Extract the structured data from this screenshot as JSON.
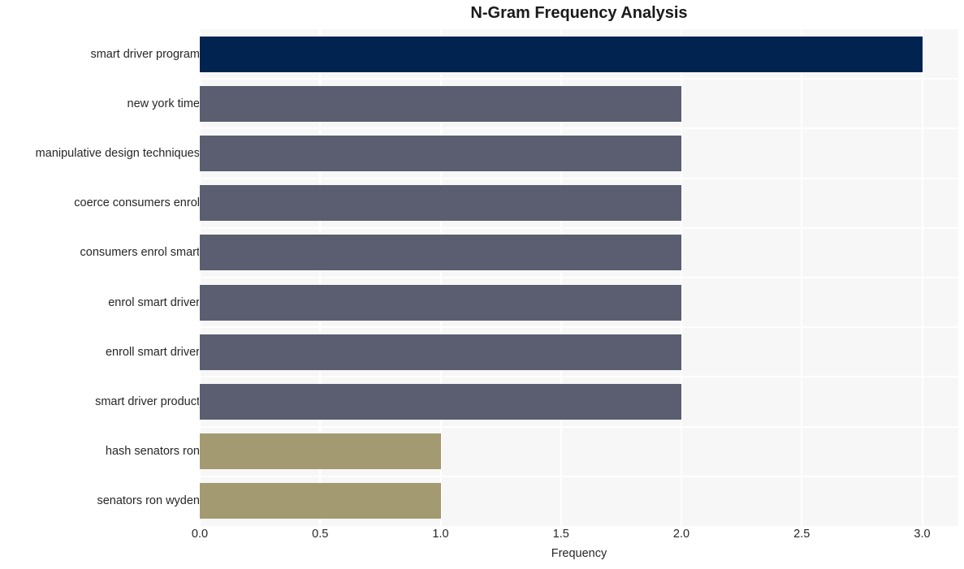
{
  "chart_data": {
    "type": "bar",
    "orientation": "horizontal",
    "title": "N-Gram Frequency Analysis",
    "xlabel": "Frequency",
    "ylabel": "",
    "xlim": [
      0.0,
      3.15
    ],
    "xticks": [
      "0.0",
      "0.5",
      "1.0",
      "1.5",
      "2.0",
      "2.5",
      "3.0"
    ],
    "xtick_values": [
      0.0,
      0.5,
      1.0,
      1.5,
      2.0,
      2.5,
      3.0
    ],
    "grid": true,
    "legend": "none",
    "categories": [
      "smart driver program",
      "new york time",
      "manipulative design techniques",
      "coerce consumers enrol",
      "consumers enrol smart",
      "enrol smart driver",
      "enroll smart driver",
      "smart driver product",
      "hash senators ron",
      "senators ron wyden"
    ],
    "values": [
      3,
      2,
      2,
      2,
      2,
      2,
      2,
      2,
      1,
      1
    ],
    "bar_colors": [
      "#012350",
      "#5a5e70",
      "#5a5e70",
      "#5a5e70",
      "#5a5e70",
      "#5a5e70",
      "#5a5e70",
      "#5a5e70",
      "#a39a72",
      "#a39a72"
    ],
    "plot_background": "#f7f7f7",
    "grid_color": "#ffffff",
    "figure_background": "#ffffff",
    "text_color": "#262626"
  }
}
